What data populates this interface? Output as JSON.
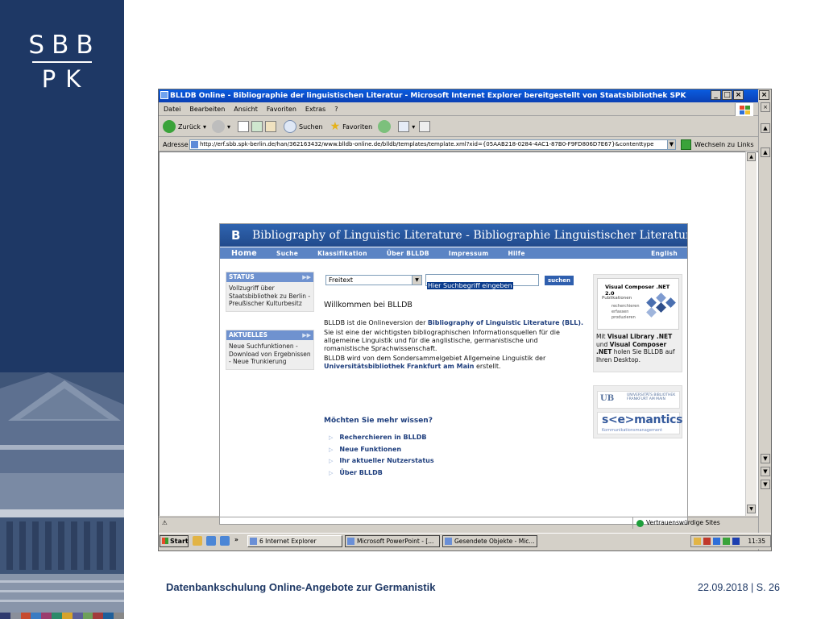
{
  "slide": {
    "logo_top": "SBB",
    "logo_bottom": "PK",
    "footer_title": "Datenbankschulung Online-Angebote zur Germanistik",
    "footer_date_page": "22.09.2018 | S. 26",
    "stripe_colors": [
      "#2f3a6e",
      "#8a8f9a",
      "#c64b2f",
      "#3b7cc2",
      "#9a3c6e",
      "#2d8a6a",
      "#d7a32b",
      "#5b5f99",
      "#6ea05a",
      "#a23c3c",
      "#1f5f9a",
      "#888888"
    ]
  },
  "ie": {
    "window_title": "BLLDB Online - Bibliographie der linguistischen Literatur - Microsoft Internet Explorer bereitgestellt von Staatsbibliothek SPK",
    "menu": [
      "Datei",
      "Bearbeiten",
      "Ansicht",
      "Favoriten",
      "Extras",
      "?"
    ],
    "toolbar": {
      "back": "Zurück",
      "search": "Suchen",
      "favorites": "Favoriten"
    },
    "address_label": "Adresse",
    "address_url": "http://erf.sbb.spk-berlin.de/han/362163432/www.blldb-online.de/blldb/templates/template.xml?xid={05AAB218-0284-4AC1-87B0-F9FD806D7E67}&contenttype",
    "go_label": "Wechseln zu",
    "links_label": "Links",
    "status_zone": "Vertrauenswürdige Sites"
  },
  "blldb": {
    "header_title": "Bibliography of Linguistic Literature - Bibliographie Linguistischer Literatur",
    "nav": [
      "Home",
      "Suche",
      "Klassifikation",
      "Über BLLDB",
      "Impressum",
      "Hilfe"
    ],
    "nav_english": "English",
    "status_title": "STATUS",
    "status_text": "Vollzugriff über Staatsbibliothek zu Berlin - Preußischer Kulturbesitz",
    "news_title": "AKTUELLES",
    "news_text": "Neue Suchfunktionen - Download von Ergebnissen - Neue Trunkierung",
    "search_select": "Freitext",
    "search_input": "Hier Suchbegriff eingeben",
    "search_button": "suchen",
    "welcome": "Willkommen bei BLLDB",
    "p1_prefix": "BLLDB ist die Onlineversion der ",
    "p1_bold": "Bibliography of Linguistic Literature (BLL).",
    "p2": "Sie ist eine der wichtigsten bibliographischen Informationsquellen für die allgemeine Linguistik und für die anglistische, germanistische und romanistische Sprachwissenschaft.",
    "p3_prefix": "BLLDB wird von dem Sondersammelgebiet Allgemeine Linguistik der ",
    "p3_bold": "Universitätsbibliothek Frankfurt am Main",
    "p3_suffix": " erstellt.",
    "more_title": "Möchten Sie mehr wissen?",
    "more_links": [
      "Recherchieren in BLLDB",
      "Neue Funktionen",
      "Ihr aktueller Nutzerstatus",
      "Über BLLDB"
    ],
    "vc_title": "Visual Composer .NET 2.0",
    "vc_pub": "Publikationen",
    "vc_items": [
      "recherchieren",
      "erfassen",
      "produzieren"
    ],
    "vc_text_1": "Mit ",
    "vc_text_b1": "Visual Library .NET",
    "vc_text_2": " und ",
    "vc_text_b2": "Visual Composer .NET",
    "vc_text_3": " holen Sie BLLDB auf Ihren Desktop.",
    "ub_mark": "UB",
    "ub_full": "UNIVERSITÄTS BIBLIOTHEK FRANKFURT AM MAIN",
    "sem_logo": "s<e>mantics",
    "sem_sub": "Kommunikationsmanagement"
  },
  "taskbar": {
    "start": "Start",
    "tasks": [
      "6 Internet Explorer",
      "Microsoft PowerPoint - [...",
      "Gesendete Objekte - Mic..."
    ],
    "clock": "11:35"
  }
}
